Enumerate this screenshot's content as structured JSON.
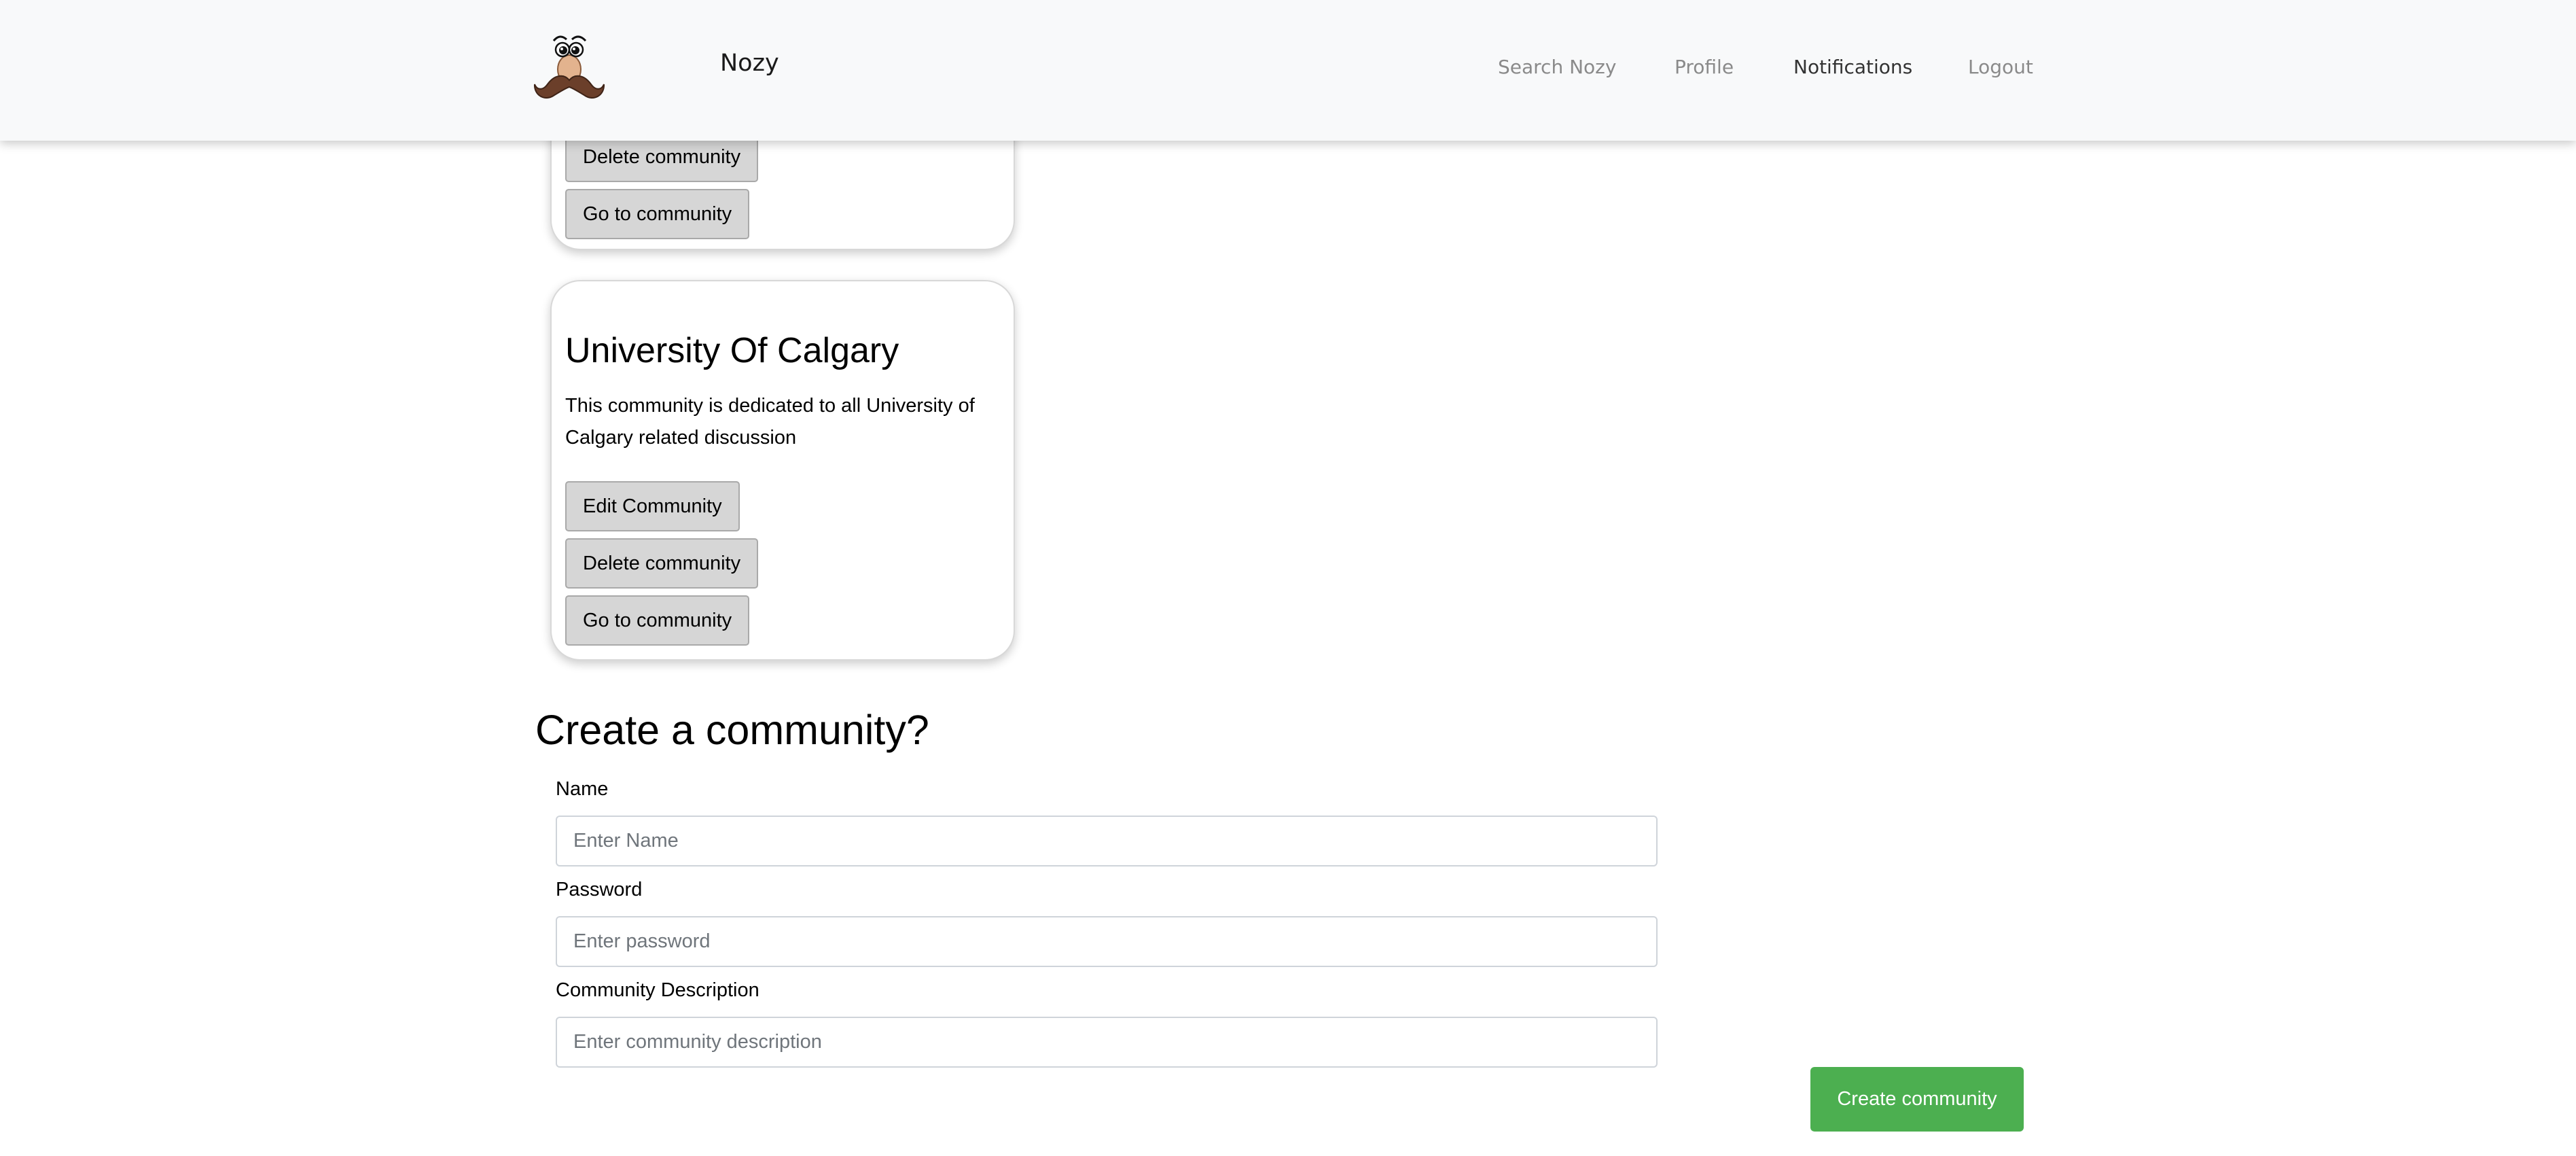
{
  "navbar": {
    "brand": "Nozy",
    "links": {
      "search": "Search Nozy",
      "profile": "Profile",
      "notifications": "Notifications",
      "logout": "Logout"
    }
  },
  "communities": [
    {
      "delete_label": "Delete community",
      "goto_label": "Go to community"
    },
    {
      "title": "University Of Calgary",
      "description": "This community is dedicated to all University of Calgary related discussion",
      "edit_label": "Edit Community",
      "delete_label": "Delete community",
      "goto_label": "Go to community"
    }
  ],
  "create_form": {
    "heading": "Create a community?",
    "name_label": "Name",
    "name_placeholder": "Enter Name",
    "name_value": "",
    "password_label": "Password",
    "password_placeholder": "Enter password",
    "password_value": "",
    "description_label": "Community Description",
    "description_placeholder": "Enter community description",
    "description_value": "",
    "submit_label": "Create community"
  },
  "colors": {
    "navbar_bg": "#f8f9fa",
    "button_bg": "#d6d6d6",
    "create_button": "#4caf50"
  }
}
